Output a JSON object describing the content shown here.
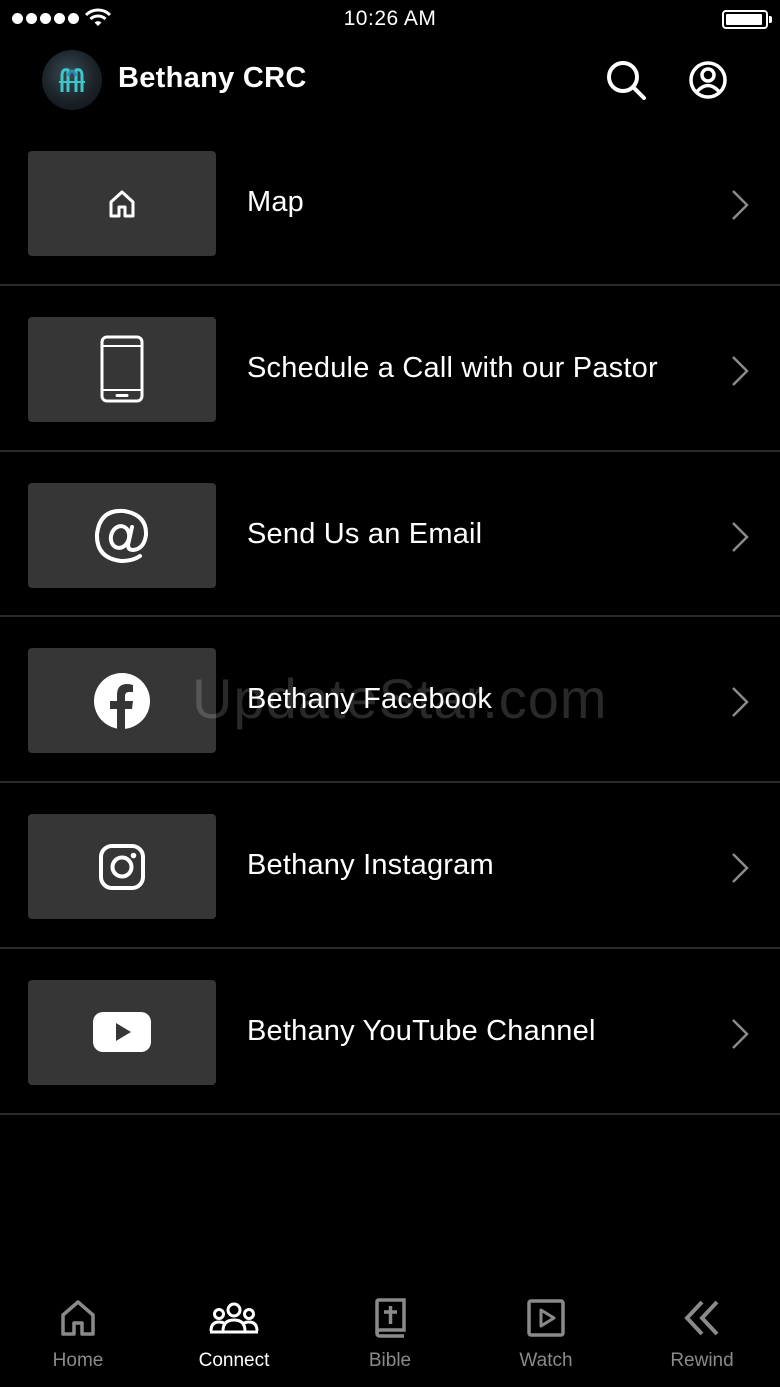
{
  "status_bar": {
    "time": "10:26 AM",
    "battery_level": 0.95
  },
  "header": {
    "title": "Bethany CRC",
    "logo_icon": "church-logo-icon",
    "search_icon": "search-icon",
    "profile_icon": "user-circle-icon"
  },
  "menu": {
    "items": [
      {
        "label": "Map",
        "icon": "home-icon"
      },
      {
        "label": "Schedule a Call with our Pastor",
        "icon": "phone-icon"
      },
      {
        "label": "Send Us an Email",
        "icon": "at-icon"
      },
      {
        "label": "Bethany Facebook",
        "icon": "facebook-icon"
      },
      {
        "label": "Bethany Instagram",
        "icon": "instagram-icon"
      },
      {
        "label": "Bethany YouTube Channel",
        "icon": "youtube-icon"
      }
    ]
  },
  "watermark": "UpdateStar.com",
  "tabs": [
    {
      "label": "Home",
      "icon": "home-icon",
      "active": false
    },
    {
      "label": "Connect",
      "icon": "people-icon",
      "active": true
    },
    {
      "label": "Bible",
      "icon": "bible-icon",
      "active": false
    },
    {
      "label": "Watch",
      "icon": "play-icon",
      "active": false
    },
    {
      "label": "Rewind",
      "icon": "rewind-icon",
      "active": false
    }
  ],
  "colors": {
    "background": "#000000",
    "tile": "#363636",
    "divider": "#2a2a2a",
    "inactive_tab": "#8a8a8a",
    "active_tab": "#ffffff"
  }
}
